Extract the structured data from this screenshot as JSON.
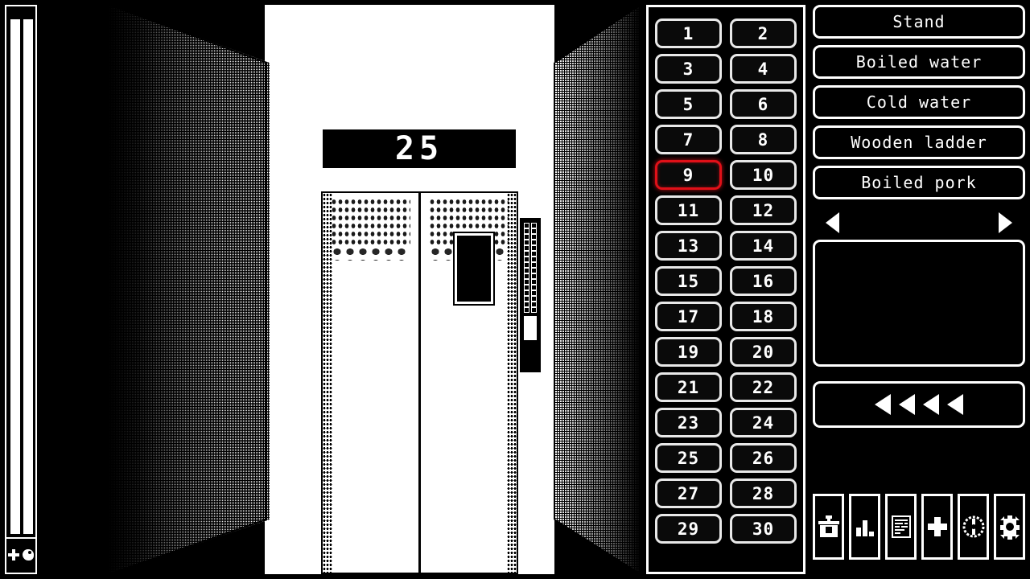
{
  "vitals": {
    "health": {
      "icon": "plus-icon",
      "value_pct": 100
    },
    "hunger": {
      "icon": "meat-icon",
      "value_pct": 100
    }
  },
  "scene": {
    "floor_display_value": "25",
    "door_state": "closed",
    "call_panel_rows": 16
  },
  "keypad": {
    "floors": [
      "1",
      "2",
      "3",
      "4",
      "5",
      "6",
      "7",
      "8",
      "9",
      "10",
      "11",
      "12",
      "13",
      "14",
      "15",
      "16",
      "17",
      "18",
      "19",
      "20",
      "21",
      "22",
      "23",
      "24",
      "25",
      "26",
      "27",
      "28",
      "29",
      "30"
    ],
    "selected_floor": "9",
    "selected_color": "#e01018"
  },
  "actions": {
    "items": [
      {
        "label": "Stand"
      },
      {
        "label": "Boiled water"
      },
      {
        "label": "Cold water"
      },
      {
        "label": "Wooden ladder"
      },
      {
        "label": "Boiled pork"
      }
    ]
  },
  "carousel": {
    "prev_icon": "triangle-left-icon",
    "next_icon": "triangle-right-icon",
    "preview_content": ""
  },
  "progress": {
    "markers": 4,
    "marker_icon": "triangle-left-icon"
  },
  "toolbar": {
    "icons": [
      {
        "name": "toolbox-icon"
      },
      {
        "name": "bar-chart-icon"
      },
      {
        "name": "document-icon"
      },
      {
        "name": "plus-icon"
      },
      {
        "name": "compass-icon"
      },
      {
        "name": "gear-icon"
      }
    ]
  },
  "theme": {
    "foreground": "#ffffff",
    "background": "#000000",
    "accent": "#e01018"
  }
}
